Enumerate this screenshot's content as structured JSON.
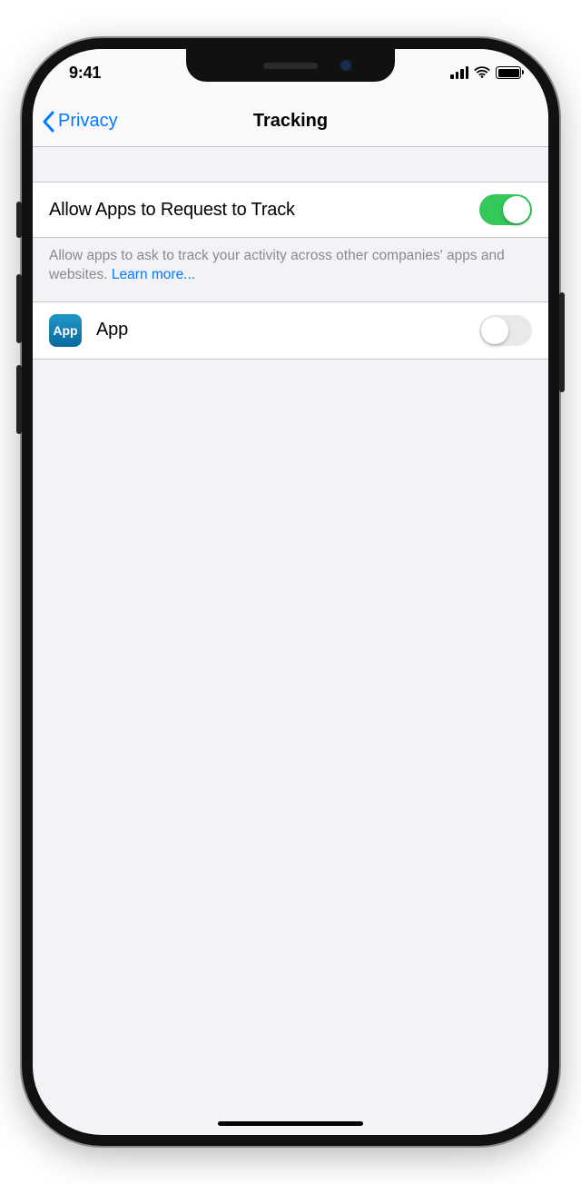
{
  "statusBar": {
    "time": "9:41"
  },
  "nav": {
    "back": "Privacy",
    "title": "Tracking"
  },
  "allowTracking": {
    "label": "Allow Apps to Request to Track",
    "enabled": true,
    "description": "Allow apps to ask to track your activity across other companies' apps and websites. ",
    "learnMore": "Learn more..."
  },
  "apps": [
    {
      "iconText": "App",
      "name": "App",
      "enabled": false
    }
  ]
}
